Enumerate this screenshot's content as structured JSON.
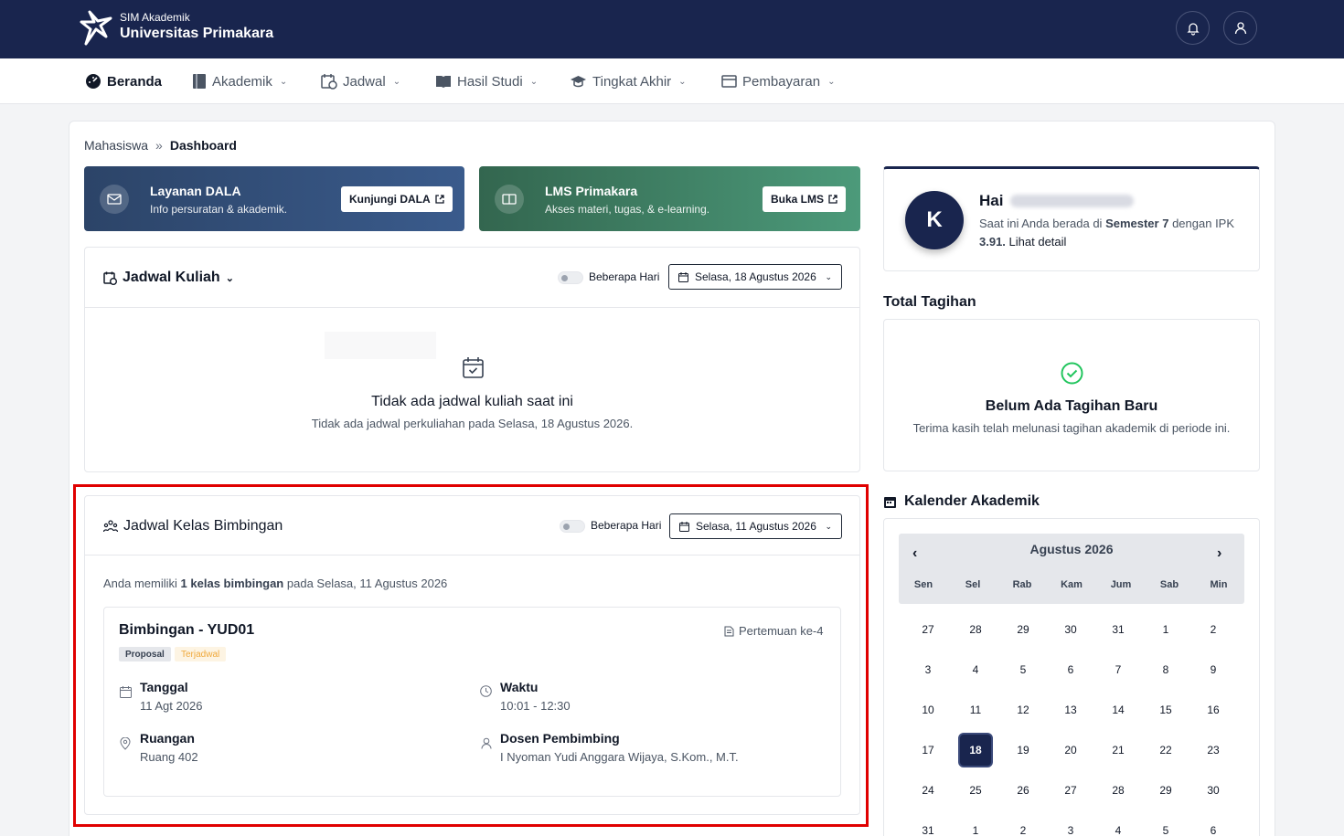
{
  "header": {
    "brand_small": "SIM Akademik",
    "brand_name": "Universitas Primakara"
  },
  "nav": {
    "items": [
      {
        "label": "Beranda",
        "icon": "dashboard-icon"
      },
      {
        "label": "Akademik",
        "icon": "book-icon"
      },
      {
        "label": "Jadwal",
        "icon": "calendar-clock-icon"
      },
      {
        "label": "Hasil Studi",
        "icon": "open-book-icon"
      },
      {
        "label": "Tingkat Akhir",
        "icon": "graduation-cap-icon"
      },
      {
        "label": "Pembayaran",
        "icon": "wallet-icon"
      }
    ]
  },
  "breadcrumb": {
    "parent": "Mahasiswa",
    "sep": "»",
    "current": "Dashboard"
  },
  "banners": [
    {
      "title": "Layanan DALA",
      "subtitle": "Info persuratan & akademik.",
      "button": "Kunjungi DALA",
      "color": "#2f4a73"
    },
    {
      "title": "LMS Primakara",
      "subtitle": "Akses materi, tugas, & e-learning.",
      "button": "Buka LMS",
      "color": "#3a7a5f"
    }
  ],
  "jadwal_kuliah": {
    "title": "Jadwal Kuliah",
    "toggle_label": "Beberapa Hari",
    "date": "Selasa, 18 Agustus 2026",
    "empty_title": "Tidak ada jadwal kuliah saat ini",
    "empty_sub": "Tidak ada jadwal perkuliahan pada Selasa, 18 Agustus 2026."
  },
  "bimbingan": {
    "title": "Jadwal Kelas Bimbingan",
    "toggle_label": "Beberapa Hari",
    "date": "Selasa, 11 Agustus 2026",
    "summary_prefix": "Anda memiliki",
    "summary_bold": "1 kelas bimbingan",
    "summary_suffix": "pada Selasa, 11 Agustus 2026",
    "class_name": "Bimbingan - YUD01",
    "meeting": "Pertemuan ke-4",
    "badge_type": "Proposal",
    "badge_status": "Terjadwal",
    "tanggal_label": "Tanggal",
    "tanggal_value": "11 Agt 2026",
    "waktu_label": "Waktu",
    "waktu_value": "10:01 - 12:30",
    "ruangan_label": "Ruangan",
    "ruangan_value": "Ruang 402",
    "dosen_label": "Dosen Pembimbing",
    "dosen_value": "I Nyoman Yudi Anggara Wijaya, S.Kom., M.T."
  },
  "profile": {
    "avatar_letter": "K",
    "greeting": "Hai",
    "line1_prefix": "Saat ini Anda berada di",
    "semester": "Semester 7",
    "line1_suffix": "dengan IPK",
    "ipk": "3.91.",
    "link": "Lihat detail"
  },
  "tagihan": {
    "heading": "Total Tagihan",
    "title": "Belum Ada Tagihan Baru",
    "subtitle": "Terima kasih telah melunasi tagihan akademik di periode ini."
  },
  "kalender": {
    "heading": "Kalender Akademik",
    "month": "Agustus 2026",
    "weekdays": [
      "Sen",
      "Sel",
      "Rab",
      "Kam",
      "Jum",
      "Sab",
      "Min"
    ],
    "weeks": [
      [
        "27",
        "28",
        "29",
        "30",
        "31",
        "1",
        "2"
      ],
      [
        "3",
        "4",
        "5",
        "6",
        "7",
        "8",
        "9"
      ],
      [
        "10",
        "11",
        "12",
        "13",
        "14",
        "15",
        "16"
      ],
      [
        "17",
        "18",
        "19",
        "20",
        "21",
        "22",
        "23"
      ],
      [
        "24",
        "25",
        "26",
        "27",
        "28",
        "29",
        "30"
      ],
      [
        "31",
        "1",
        "2",
        "3",
        "4",
        "5",
        "6"
      ]
    ],
    "selected": "18"
  }
}
